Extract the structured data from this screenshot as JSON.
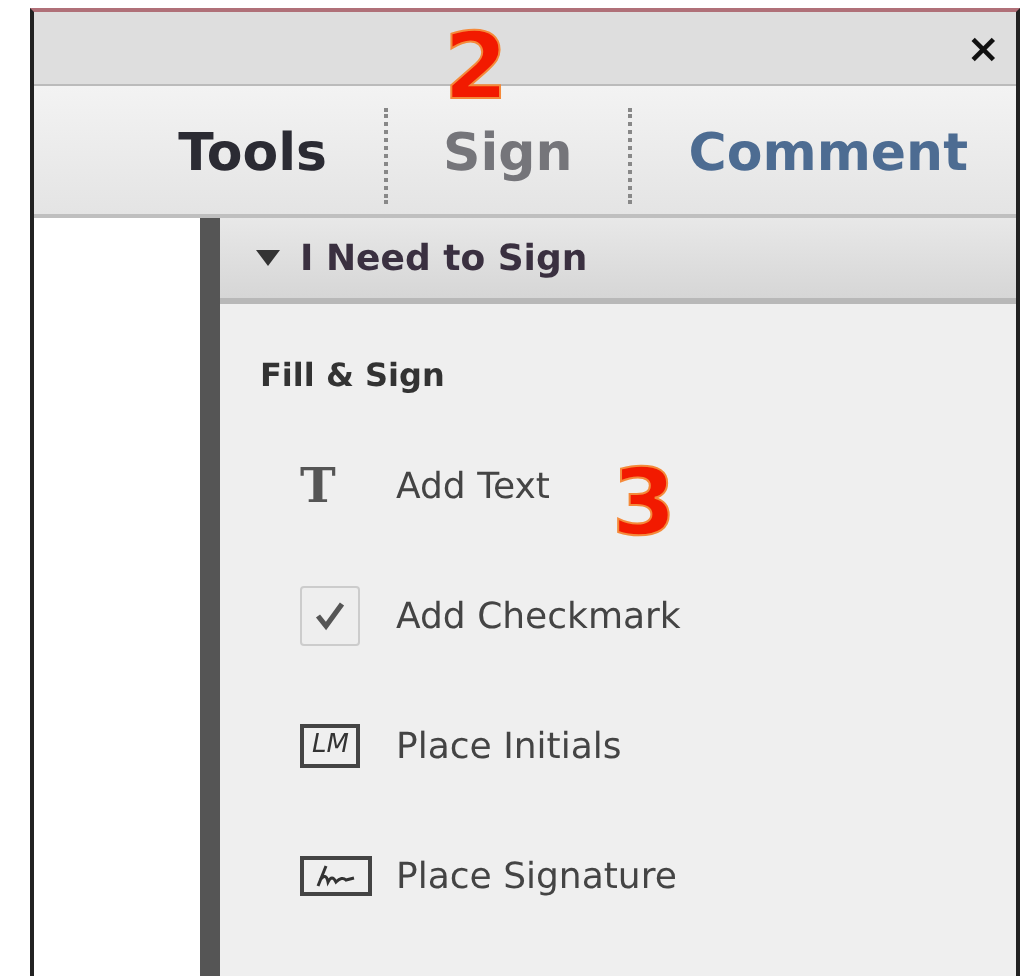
{
  "window": {
    "close": "×"
  },
  "tabs": [
    {
      "label": "Tools",
      "color": "#2b2b33"
    },
    {
      "label": "Sign",
      "color": "#75757a"
    },
    {
      "label": "Comment",
      "color": "#4d6c92"
    }
  ],
  "panel": {
    "title": "I Need to Sign",
    "expanded": true,
    "group": "Fill & Sign",
    "items": [
      {
        "kind": "text",
        "icon_text": "T",
        "label": "Add Text"
      },
      {
        "kind": "checkmark",
        "label": "Add Checkmark"
      },
      {
        "kind": "initials",
        "icon_text": "LM",
        "label": "Place Initials"
      },
      {
        "kind": "signature",
        "label": "Place Signature"
      }
    ]
  },
  "annotations": [
    {
      "label": "2",
      "kind": "upper"
    },
    {
      "label": "3",
      "kind": "lower"
    }
  ]
}
